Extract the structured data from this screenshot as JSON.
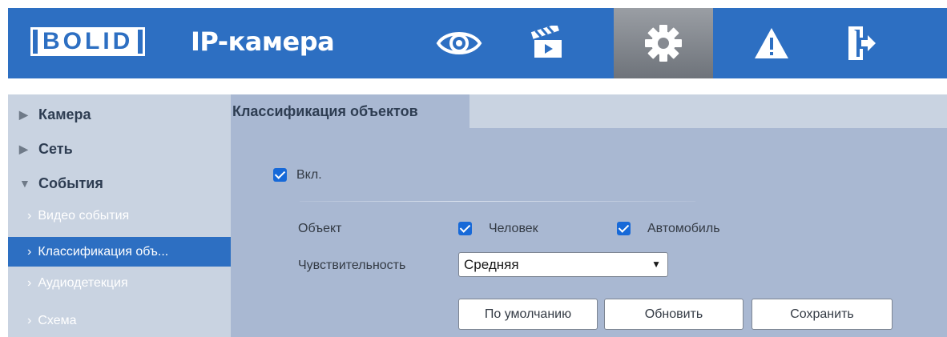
{
  "header": {
    "logo_text": "BOLID",
    "app_title": "IP-камера",
    "nav": [
      {
        "icon": "eye-icon",
        "active": false
      },
      {
        "icon": "clapperboard-icon",
        "active": false
      },
      {
        "icon": "gear-icon",
        "active": true
      },
      {
        "icon": "warning-icon",
        "active": false
      },
      {
        "icon": "exit-icon",
        "active": false
      }
    ]
  },
  "sidebar": {
    "items": [
      {
        "label": "Камера",
        "expanded": false
      },
      {
        "label": "Сеть",
        "expanded": false
      },
      {
        "label": "События",
        "expanded": true
      }
    ],
    "sub_items": [
      {
        "label": "Видео события",
        "active": false
      },
      {
        "label": "Классификация объ...",
        "active": true
      },
      {
        "label": "Аудиодетекция",
        "active": false
      },
      {
        "label": "Схема",
        "active": false
      }
    ]
  },
  "main": {
    "tab": "Классификация объектов",
    "enable": {
      "label": "Вкл.",
      "checked": true
    },
    "object_label": "Объект",
    "objects": [
      {
        "label": "Человек",
        "checked": true
      },
      {
        "label": "Автомобиль",
        "checked": true
      }
    ],
    "sensitivity_label": "Чувствительность",
    "sensitivity_value": "Средняя",
    "buttons": {
      "default": "По умолчанию",
      "refresh": "Обновить",
      "save": "Сохранить"
    }
  },
  "colors": {
    "header_bg": "#2d6fc2",
    "sidebar_bg": "#c9d3e1",
    "content_bg": "#a9b8d2",
    "active_item": "#2d6fc2",
    "checkbox": "#1769d8"
  }
}
